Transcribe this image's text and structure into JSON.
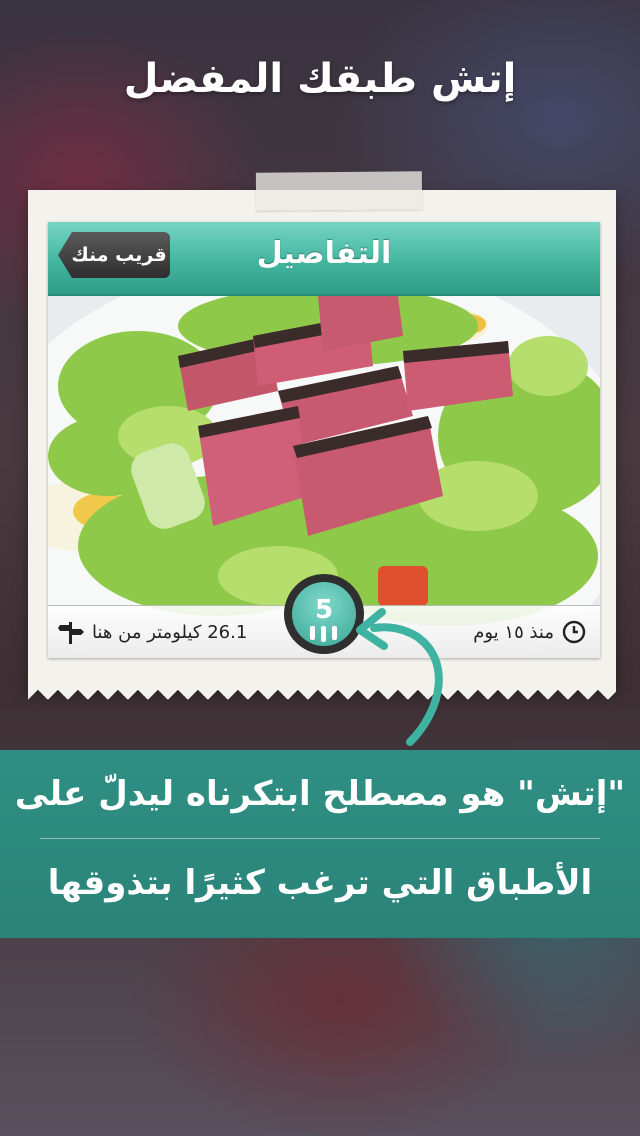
{
  "headline": "إتش طبقك المفضل",
  "screen": {
    "nav_title": "التفاصيل",
    "back_button": "قريب منك",
    "time_label": "منذ ١٥ يوم",
    "distance_label": "26.1 كيلومتر من هنا",
    "rating_count": "5"
  },
  "banner": {
    "line1": "\"إتش\" هو مصطلح ابتكرناه ليدلّ على",
    "line2": "الأطباق التي ترغب كثيرًا بتذوقها"
  },
  "colors": {
    "accent_teal": "#43b6a0",
    "banner_teal": "#2f8f84"
  },
  "icons": [
    "clock-icon",
    "signpost-icon",
    "curved-arrow-icon",
    "fork-badge-icon"
  ]
}
